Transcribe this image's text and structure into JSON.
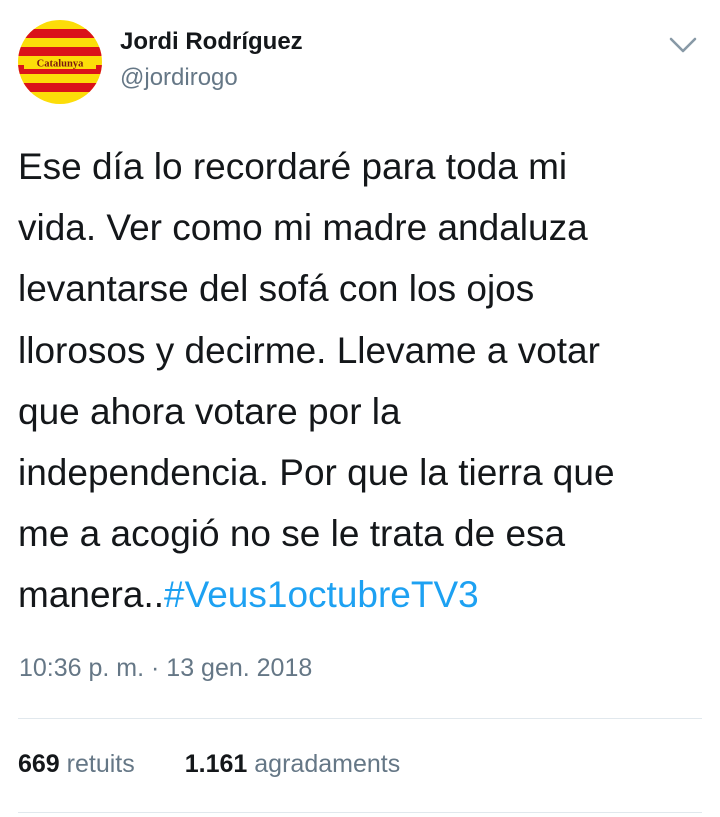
{
  "author": {
    "avatar_icon": "catalonia-flag-avatar-icon",
    "avatar_text": "Catalunya",
    "name": "Jordi Rodríguez",
    "handle": "@jordirogo"
  },
  "menu": {
    "icon": "chevron-down-icon"
  },
  "tweet": {
    "lines": [
      "Ese día lo recordaré para toda mi",
      "vida. Ver como mi madre andaluza",
      "levantarse del sofá con los ojos",
      "llorosos y decirme. Llevame a votar",
      "que ahora votare por la",
      "independencia. Por que la tierra que",
      "me a acogió no se le trata de esa"
    ],
    "last_line_text": "manera..",
    "hashtag": "#Veus1octubreTV3",
    "timestamp": "10:36 p. m. · 13 gen. 2018"
  },
  "stats": {
    "retweets_count": "669",
    "retweets_label": "retuits",
    "likes_count": "1.161",
    "likes_label": "agradaments"
  },
  "colors": {
    "text": "#14171a",
    "secondary": "#657786",
    "link": "#1da1f2",
    "divider": "#e1e8ed",
    "flag_yellow": "#fcdd09",
    "flag_red": "#da121a"
  }
}
